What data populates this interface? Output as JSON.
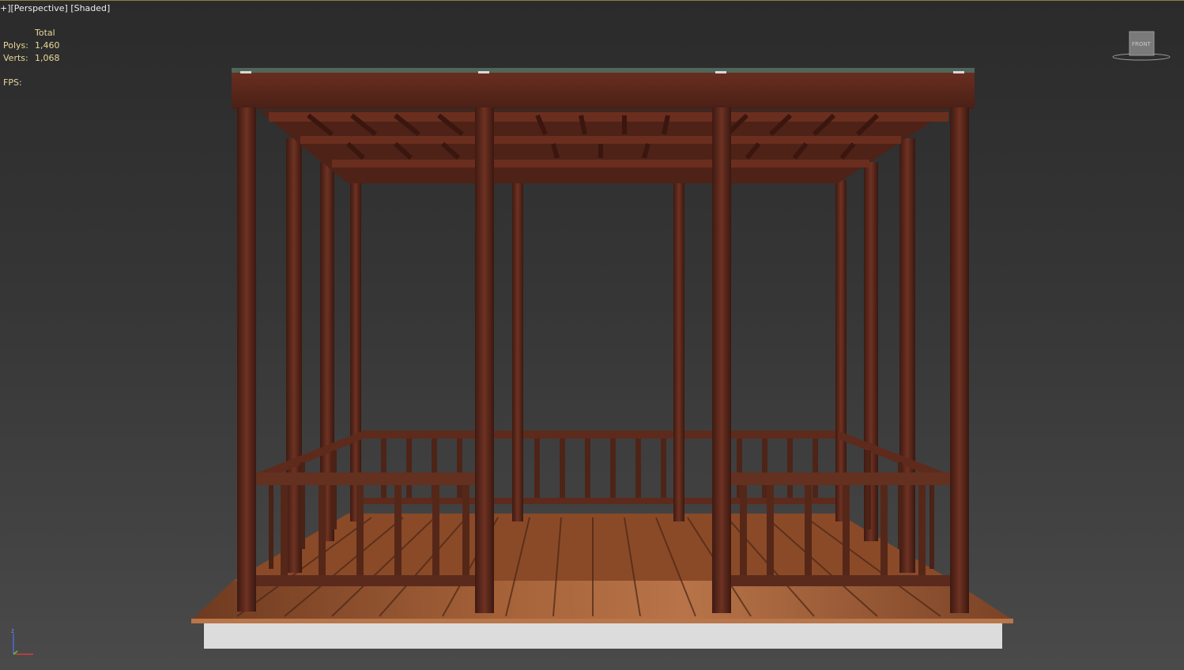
{
  "viewport": {
    "plus": "+",
    "view": "[Perspective]",
    "shading": "[Shaded]"
  },
  "stats": {
    "header": "Total",
    "polys_label": "Polys:",
    "polys_value": "1,460",
    "verts_label": "Verts:",
    "verts_value": "1,068",
    "fps_label": "FPS:"
  },
  "viewcube": {
    "face": "FRONT"
  },
  "axis": {
    "z": "z"
  },
  "colors": {
    "wood": "#5a2a1c",
    "wood_light": "#7a3a26",
    "floor": "#9a5a30",
    "base": "#dcdcdc"
  },
  "icons": [
    "viewcube-icon",
    "axis-tripod-icon"
  ]
}
